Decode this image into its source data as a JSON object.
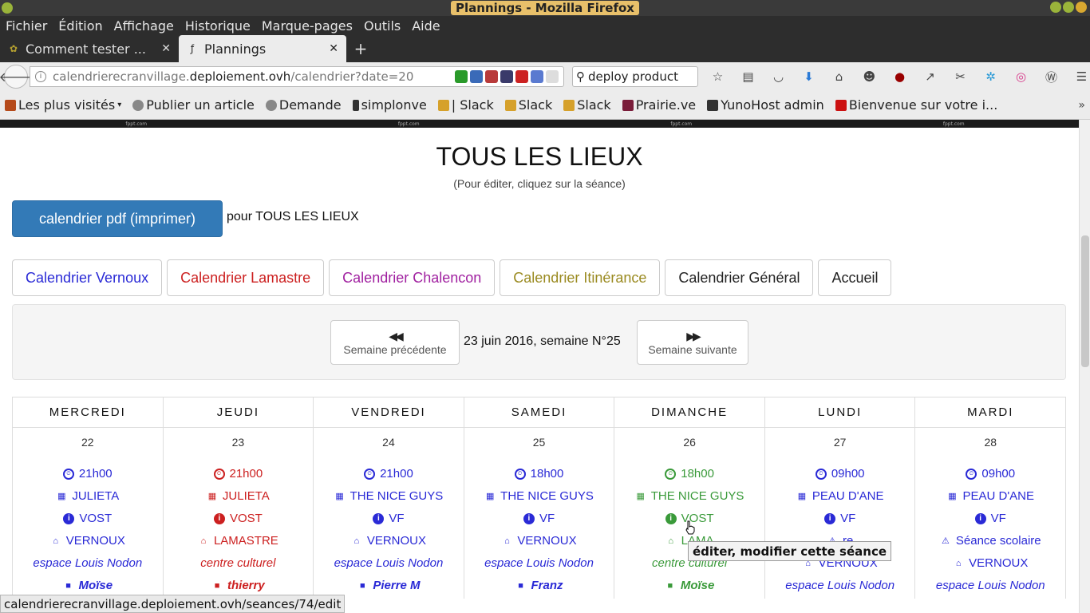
{
  "window": {
    "title": "Plannings - Mozilla Firefox"
  },
  "menu": [
    "Fichier",
    "Édition",
    "Affichage",
    "Historique",
    "Marque-pages",
    "Outils",
    "Aide"
  ],
  "tabs": [
    {
      "label": "Comment tester ...",
      "active": false
    },
    {
      "label": "Plannings",
      "active": true
    }
  ],
  "newtab_label": "+",
  "url": {
    "prefix": "calendrierecranvillage.",
    "domain": "deploiement.ovh",
    "path": "/calendrier?date=20"
  },
  "search": {
    "value": "deploy product"
  },
  "bookmarks": [
    {
      "label": "Les plus visités",
      "color": "#b54a1a"
    },
    {
      "label": "Publier un article",
      "color": "#777"
    },
    {
      "label": "Demande",
      "color": "#777"
    },
    {
      "label": "simplonve",
      "color": "#333"
    },
    {
      "label": "| Slack",
      "color": "#d6a12b"
    },
    {
      "label": "Slack",
      "color": "#d6a12b"
    },
    {
      "label": "Slack",
      "color": "#d6a12b"
    },
    {
      "label": "Prairie.ve",
      "color": "#7a1d3a"
    },
    {
      "label": "YunoHost admin",
      "color": "#333"
    },
    {
      "label": "Bienvenue sur votre i...",
      "color": "#c11"
    }
  ],
  "ad": [
    "fppt.com",
    "fppt.com",
    "fppt.com",
    "fppt.com"
  ],
  "page": {
    "title": "TOUS LES LIEUX",
    "subtitle": "(Pour éditer, cliquez sur la séance)",
    "pdf_button": "calendrier pdf (imprimer)",
    "pdf_for": "pour TOUS LES LIEUX"
  },
  "cal_links": [
    {
      "label": "Calendrier Vernoux",
      "color": "#2a2ad6"
    },
    {
      "label": "Calendrier Lamastre",
      "color": "#cc2020"
    },
    {
      "label": "Calendrier Chalencon",
      "color": "#a020a0"
    },
    {
      "label": "Calendrier Itinérance",
      "color": "#9a8a20"
    },
    {
      "label": "Calendrier Général",
      "color": "#222222"
    },
    {
      "label": "Accueil",
      "color": "#222222"
    }
  ],
  "week": {
    "prev": "Semaine précédente",
    "label": "23 juin 2016, semaine N°25",
    "next": "Semaine suivante"
  },
  "days": [
    {
      "name": "MERCREDI",
      "num": "22",
      "color": "#2a2ad6",
      "time": "21h00",
      "film": "JULIETA",
      "version": "VOST",
      "extra": "",
      "place": "VERNOUX",
      "venue": "espace Louis Nodon",
      "host": "Moïse"
    },
    {
      "name": "JEUDI",
      "num": "23",
      "color": "#cc2020",
      "time": "21h00",
      "film": "JULIETA",
      "version": "VOST",
      "extra": "",
      "place": "LAMASTRE",
      "venue": "centre culturel",
      "host": "thierry"
    },
    {
      "name": "VENDREDI",
      "num": "24",
      "color": "#2a2ad6",
      "time": "21h00",
      "film": "THE NICE GUYS",
      "version": "VF",
      "extra": "",
      "place": "VERNOUX",
      "venue": "espace Louis Nodon",
      "host": "Pierre M"
    },
    {
      "name": "SAMEDI",
      "num": "25",
      "color": "#2a2ad6",
      "time": "18h00",
      "film": "THE NICE GUYS",
      "version": "VF",
      "extra": "",
      "place": "VERNOUX",
      "venue": "espace Louis Nodon",
      "host": "Franz"
    },
    {
      "name": "DIMANCHE",
      "num": "26",
      "color": "#3a9a3a",
      "time": "18h00",
      "film": "THE NICE GUYS",
      "version": "VOST",
      "extra": "",
      "place": "LAMA",
      "venue": "centre culturel",
      "host": "Moïse"
    },
    {
      "name": "LUNDI",
      "num": "27",
      "color": "#2a2ad6",
      "time": "09h00",
      "film": "PEAU D'ANE",
      "version": "VF",
      "extra": "re",
      "place": "VERNOUX",
      "venue": "espace Louis Nodon",
      "host": ""
    },
    {
      "name": "MARDI",
      "num": "28",
      "color": "#2a2ad6",
      "time": "09h00",
      "film": "PEAU D'ANE",
      "version": "VF",
      "extra": "Séance scolaire",
      "place": "VERNOUX",
      "venue": "espace Louis Nodon",
      "host": ""
    }
  ],
  "tooltip": "éditer, modifier cette séance",
  "status": "calendrierecranvillage.deploiement.ovh/seances/74/edit"
}
